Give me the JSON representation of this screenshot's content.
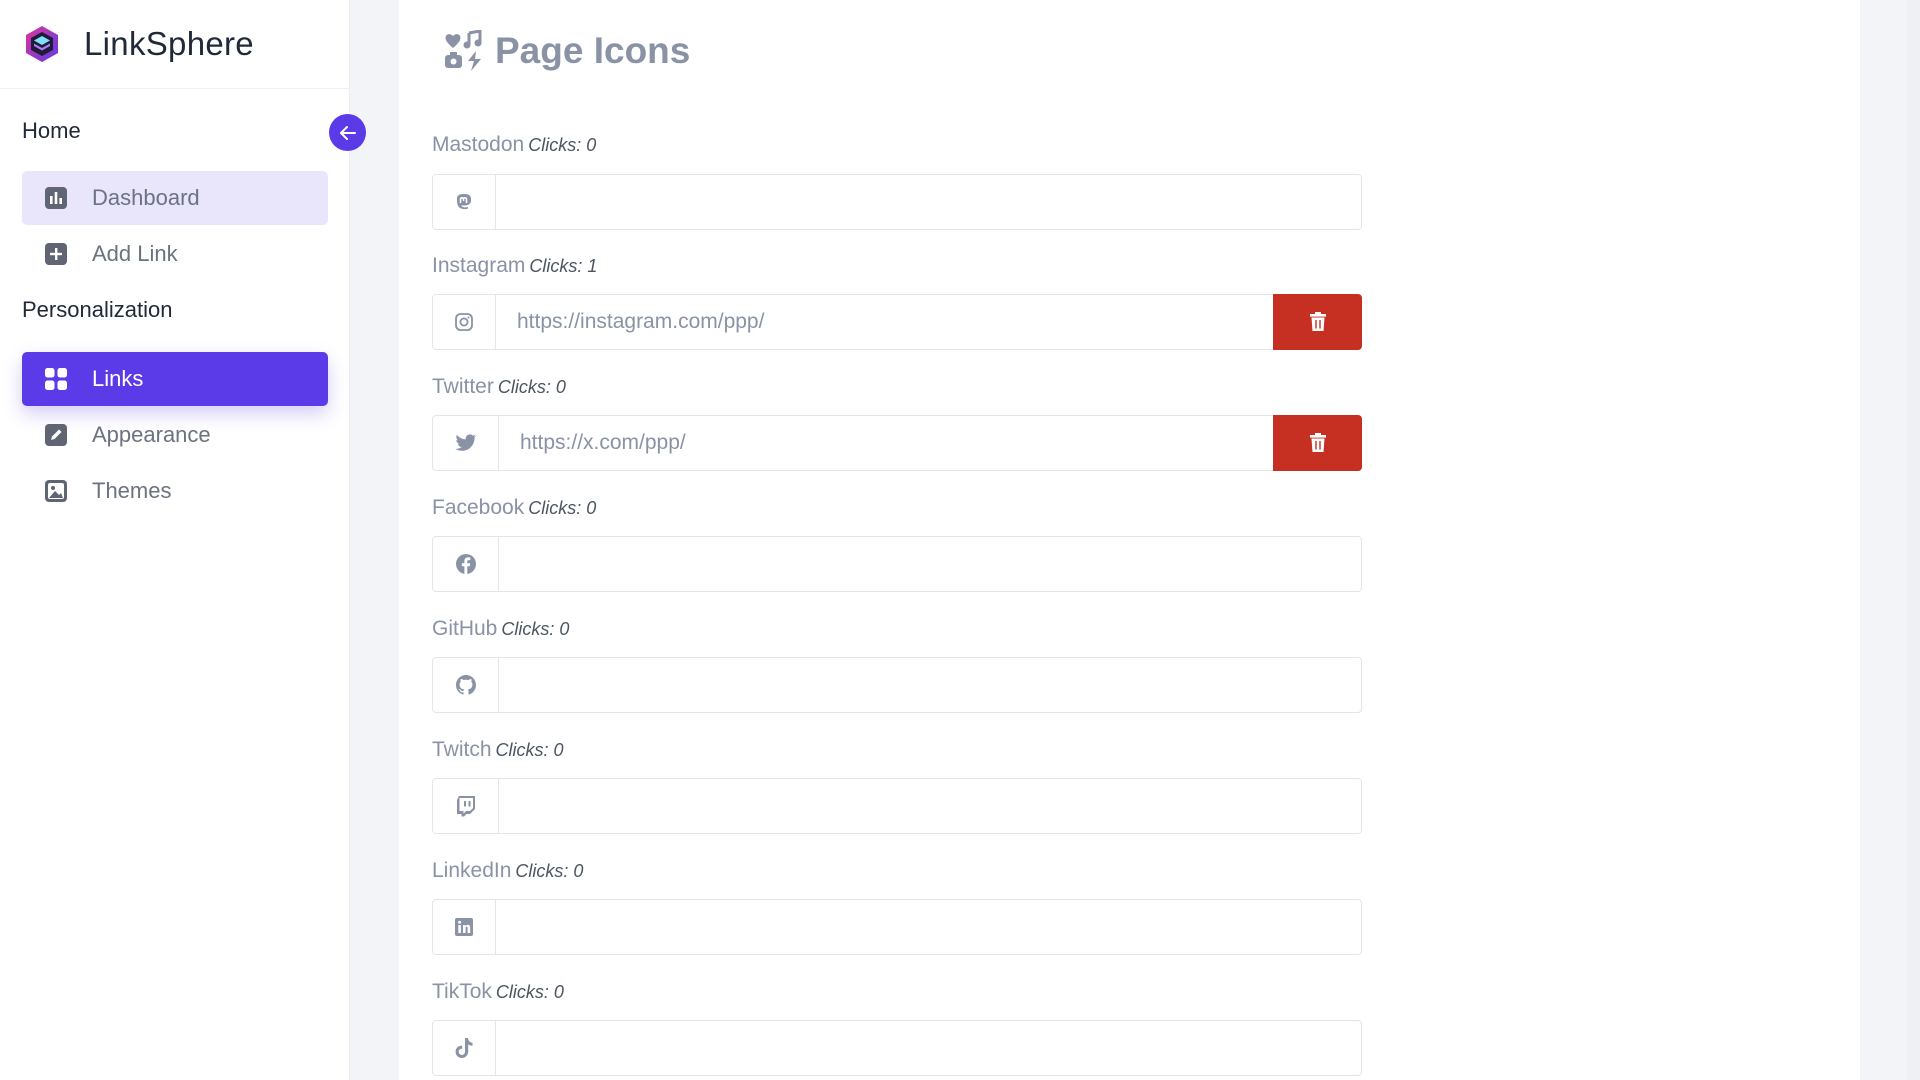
{
  "brand": {
    "name": "LinkSphere"
  },
  "sidebar": {
    "sections": [
      {
        "title": "Home"
      },
      {
        "title": "Personalization"
      }
    ],
    "items": [
      {
        "label": "Dashboard",
        "icon": "chart-bar-icon"
      },
      {
        "label": "Add Link",
        "icon": "plus-square-icon"
      },
      {
        "label": "Links",
        "icon": "grid-icon"
      },
      {
        "label": "Appearance",
        "icon": "edit-icon"
      },
      {
        "label": "Themes",
        "icon": "image-icon"
      }
    ]
  },
  "main": {
    "title": "Page Icons",
    "fields": [
      {
        "name": "Mastodon",
        "clicks": "Clicks: 0",
        "icon": "mastodon-icon",
        "value": ""
      },
      {
        "name": "Instagram",
        "clicks": "Clicks: 1",
        "icon": "instagram-icon",
        "value": "https://instagram.com/ppp/"
      },
      {
        "name": "Twitter",
        "clicks": "Clicks: 0",
        "icon": "twitter-icon",
        "value": "https://x.com/ppp/"
      },
      {
        "name": "Facebook",
        "clicks": "Clicks: 0",
        "icon": "facebook-icon",
        "value": ""
      },
      {
        "name": "GitHub",
        "clicks": "Clicks: 0",
        "icon": "github-icon",
        "value": ""
      },
      {
        "name": "Twitch",
        "clicks": "Clicks: 0",
        "icon": "twitch-icon",
        "value": ""
      },
      {
        "name": "LinkedIn",
        "clicks": "Clicks: 0",
        "icon": "linkedin-icon",
        "value": ""
      },
      {
        "name": "TikTok",
        "clicks": "Clicks: 0",
        "icon": "tiktok-icon",
        "value": ""
      }
    ]
  },
  "colors": {
    "accent": "#5b3be8",
    "danger": "#c53023",
    "muted_text": "#8a92a6"
  }
}
